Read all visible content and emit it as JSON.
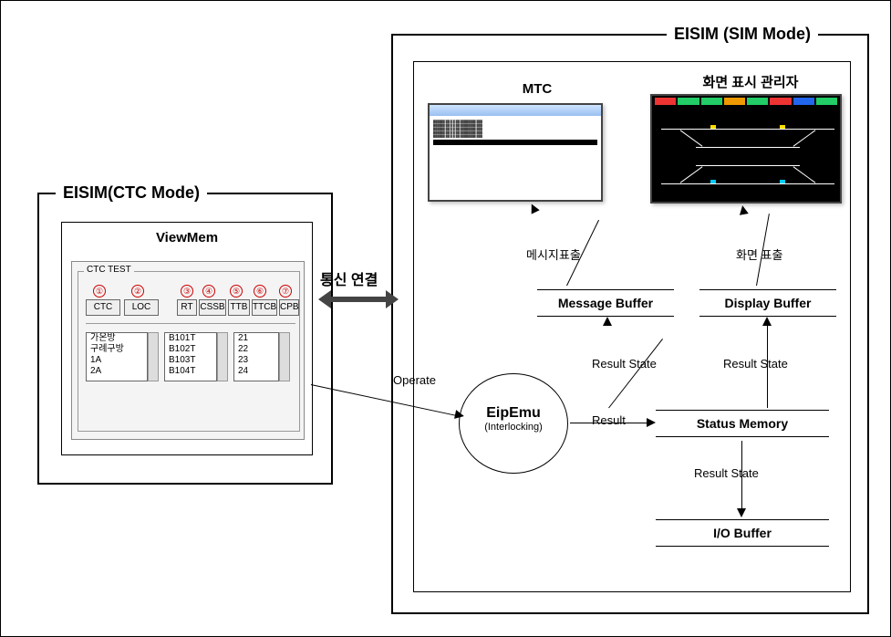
{
  "left": {
    "title": "EISIM(CTC Mode)",
    "viewmem_title": "ViewMem",
    "ctc_test_label": "CTC TEST",
    "tab_nums": [
      "①",
      "②",
      "③",
      "④",
      "⑤",
      "⑥",
      "⑦"
    ],
    "tabs": [
      "CTC",
      "LOC",
      "RT",
      "CSSB",
      "TTB",
      "TTCB",
      "CPB"
    ],
    "list1": [
      "가온방",
      "구례구방",
      "1A",
      "2A"
    ],
    "list2": [
      "B101T",
      "B102T",
      "B103T",
      "B104T"
    ],
    "list3": [
      "21",
      "22",
      "23",
      "24"
    ]
  },
  "center": {
    "link_label": "통신 연결",
    "operate_label": "Operate"
  },
  "right": {
    "title": "EISIM (SIM Mode)",
    "mtc_title": "MTC",
    "disp_title": "화면 표시 관리자",
    "msg_out_label": "메시지표출",
    "disp_out_label": "화면 표출",
    "message_buffer": "Message Buffer",
    "display_buffer": "Display Buffer",
    "status_memory": "Status Memory",
    "io_buffer": "I/O Buffer",
    "result_state": "Result State",
    "result": "Result",
    "eipemu_title": "EipEmu",
    "eipemu_sub": "(Interlocking)"
  }
}
